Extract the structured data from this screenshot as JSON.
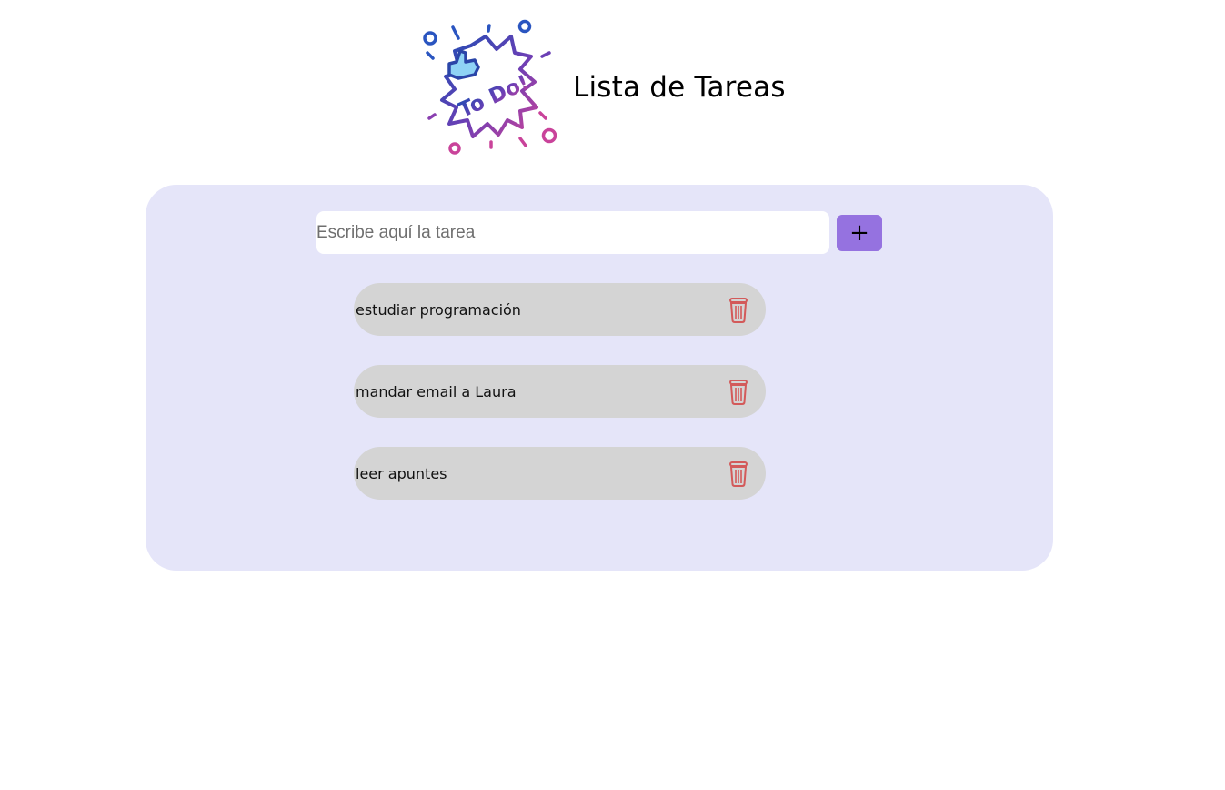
{
  "header": {
    "title": "Lista de Tareas",
    "logo_icon": "todo-burst-logo-icon"
  },
  "colors": {
    "panel_background": "#e5e5f9",
    "add_button": "#9572e0",
    "task_background": "#d4d4d4",
    "delete_icon": "#d35a5a"
  },
  "form": {
    "input_placeholder": "Escribe aquí la tarea",
    "input_value": "",
    "add_label": "+"
  },
  "tasks": [
    {
      "text": "estudiar programación",
      "delete_icon": "trash-icon"
    },
    {
      "text": "mandar email a Laura",
      "delete_icon": "trash-icon"
    },
    {
      "text": "leer apuntes",
      "delete_icon": "trash-icon"
    }
  ]
}
